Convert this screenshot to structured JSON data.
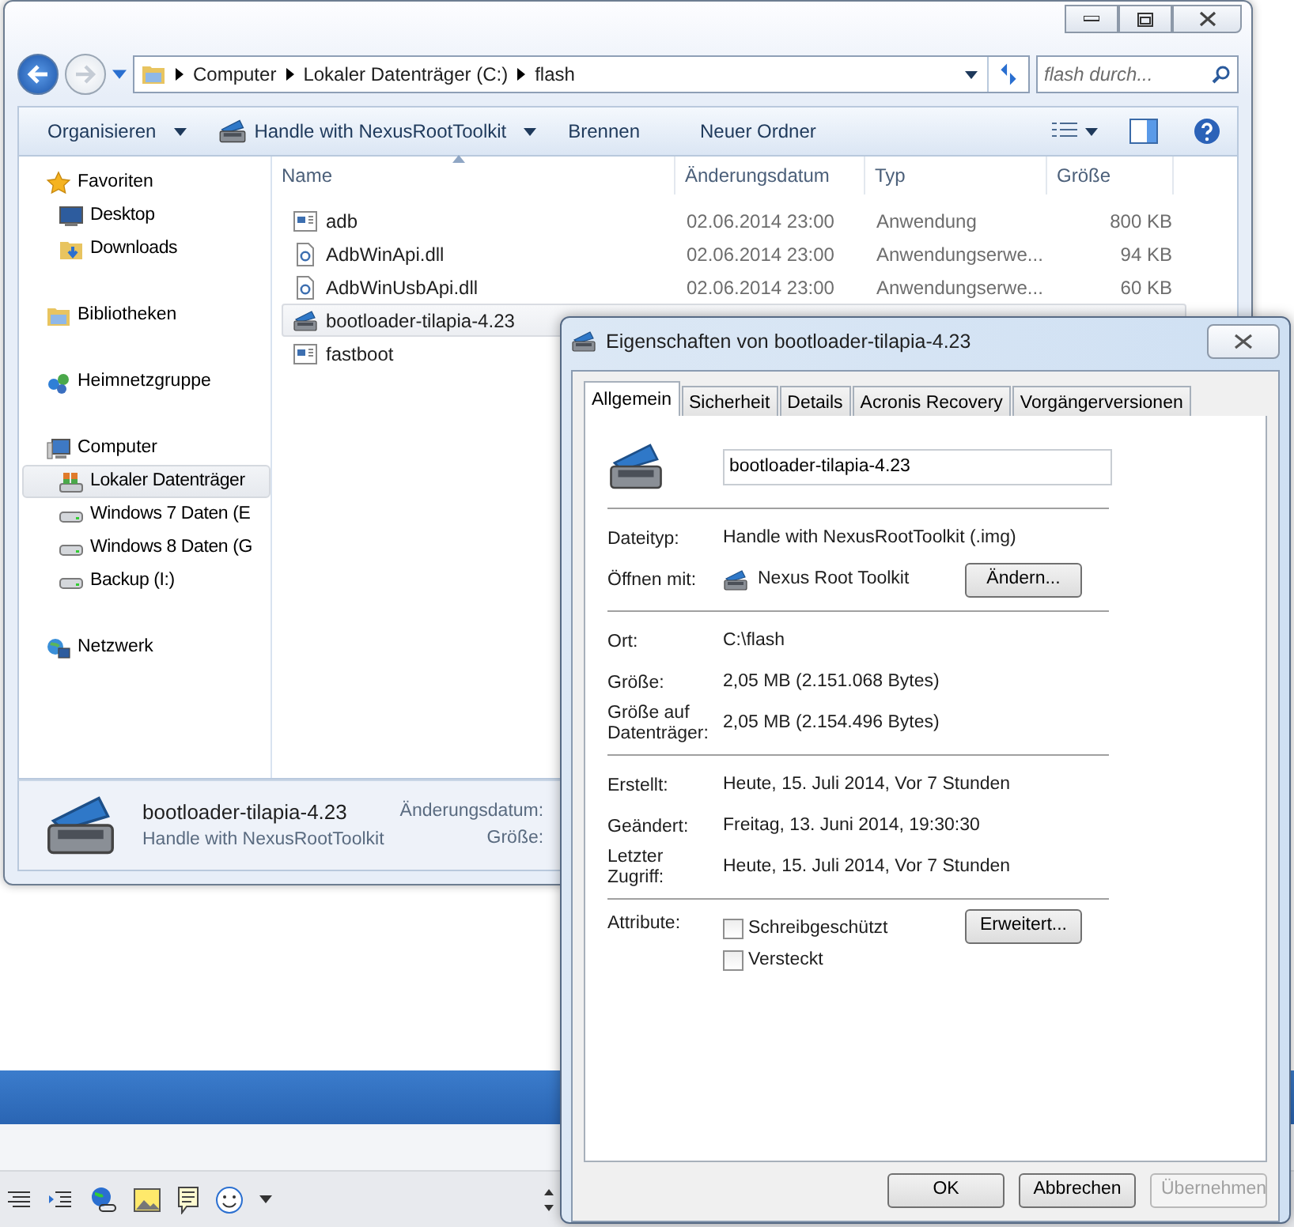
{
  "explorer": {
    "address_path": [
      "Computer",
      "Lokaler Datenträger (C:)",
      "flash"
    ],
    "search": {
      "placeholder": "flash durch..."
    },
    "commands": [
      {
        "label": "Organisieren",
        "kind": "plain",
        "dropdown": true
      },
      {
        "label": "Handle with NexusRootToolkit",
        "kind": "toolbox",
        "dropdown": true
      },
      {
        "label": "Brennen",
        "kind": "plain",
        "dropdown": false
      },
      {
        "label": "Neuer Ordner",
        "kind": "plain",
        "dropdown": false
      }
    ],
    "sidebar": [
      {
        "label": "Favoriten",
        "kind": "star",
        "selected": false,
        "children": [
          {
            "label": "Desktop",
            "kind": "desktop",
            "selected": false
          },
          {
            "label": "Downloads",
            "kind": "downloads",
            "selected": false
          }
        ]
      },
      {
        "label": "Bibliotheken",
        "kind": "library",
        "selected": false
      },
      {
        "label": "Heimnetzgruppe",
        "kind": "homegroup",
        "selected": false
      },
      {
        "label": "Computer",
        "kind": "computer",
        "selected": false,
        "children": [
          {
            "label": "Lokaler Datenträger",
            "kind": "systemdrive",
            "selected": true
          },
          {
            "label": "Windows 7 Daten (E",
            "kind": "drive",
            "selected": false
          },
          {
            "label": "Windows 8 Daten (G",
            "kind": "drive",
            "selected": false
          },
          {
            "label": "Backup (I:)",
            "kind": "drive",
            "selected": false
          }
        ]
      },
      {
        "label": "Netzwerk",
        "kind": "network",
        "selected": false
      }
    ],
    "columns": [
      {
        "label": "Name",
        "sorted": true
      },
      {
        "label": "Änderungsdatum",
        "sorted": false
      },
      {
        "label": "Typ",
        "sorted": false
      },
      {
        "label": "Größe",
        "sorted": false
      }
    ],
    "files": [
      {
        "name": "adb",
        "kind": "exe",
        "date": "02.06.2014 23:00",
        "type": "Anwendung",
        "size": "800 KB",
        "selected": false
      },
      {
        "name": "AdbWinApi.dll",
        "kind": "dll",
        "date": "02.06.2014 23:00",
        "type": "Anwendungserwe...",
        "size": "94 KB",
        "selected": false
      },
      {
        "name": "AdbWinUsbApi.dll",
        "kind": "dll",
        "date": "02.06.2014 23:00",
        "type": "Anwendungserwe...",
        "size": "60 KB",
        "selected": false
      },
      {
        "name": "bootloader-tilapia-4.23",
        "kind": "toolbox",
        "selected": true
      },
      {
        "name": "fastboot",
        "kind": "exe",
        "selected": false
      }
    ],
    "details": {
      "name": "bootloader-tilapia-4.23",
      "type": "Handle with NexusRootToolkit",
      "labels": [
        "Änderungsdatum:",
        "Größe:"
      ]
    }
  },
  "dialog": {
    "title": "Eigenschaften von bootloader-tilapia-4.23",
    "tabs": [
      {
        "label": "Allgemein",
        "selected": true
      },
      {
        "label": "Sicherheit",
        "selected": false
      },
      {
        "label": "Details",
        "selected": false
      },
      {
        "label": "Acronis Recovery",
        "selected": false
      },
      {
        "label": "Vorgängerversionen",
        "selected": false
      }
    ],
    "filename": "bootloader-tilapia-4.23",
    "sections": [
      [
        {
          "label": "Dateityp:",
          "value": "Handle with NexusRootToolkit (.img)"
        },
        {
          "label": "Öffnen mit:",
          "value": "Nexus Root Toolkit",
          "kind": "app",
          "button": "Ändern..."
        }
      ],
      [
        {
          "label": "Ort:",
          "value": "C:\\flash"
        },
        {
          "label": "Größe:",
          "value": "2,05 MB (2.151.068 Bytes)"
        },
        {
          "label": "Größe auf Datenträger:",
          "value": "2,05 MB (2.154.496 Bytes)"
        }
      ],
      [
        {
          "label": "Erstellt:",
          "value": "Heute, 15. Juli 2014, Vor 7 Stunden"
        },
        {
          "label": "Geändert:",
          "value": "Freitag, 13. Juni 2014, 19:30:30"
        },
        {
          "label": "Letzter Zugriff:",
          "value": "Heute, 15. Juli 2014, Vor 7 Stunden"
        }
      ]
    ],
    "attributes": {
      "label": "Attribute:",
      "button": "Erweitert...",
      "checkboxes": [
        {
          "label": "Schreibgeschützt",
          "checked": false
        },
        {
          "label": "Versteckt",
          "checked": false
        }
      ]
    },
    "buttons": [
      {
        "label": "OK",
        "disabled": false
      },
      {
        "label": "Abbrechen",
        "disabled": false
      },
      {
        "label": "Übernehmen",
        "disabled": true
      }
    ]
  }
}
